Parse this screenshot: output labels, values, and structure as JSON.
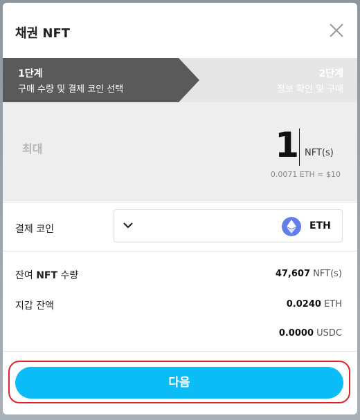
{
  "dialog": {
    "title_prefix": "채권",
    "title_suffix": "NFT"
  },
  "steps": [
    {
      "number": "1",
      "suffix": "단계",
      "label": "구매 수량 및 결제 코인 선택",
      "active": true
    },
    {
      "number": "2",
      "suffix": "단계",
      "label": "정보 확인 및 구매",
      "active": false
    }
  ],
  "quantity": {
    "max_label": "최대",
    "value": "1",
    "unit": "NFT(s)",
    "conversion": "0.0071 ETH ≈ $10"
  },
  "payment": {
    "label": "결제 코인",
    "selected_coin": "ETH",
    "coin_icon": "ethereum-icon"
  },
  "info": {
    "remaining_label_pre": "잔여",
    "remaining_label_bold": "NFT",
    "remaining_label_post": "수량",
    "remaining_value": "47,607",
    "remaining_unit": "NFT(s)",
    "wallet_label": "지갑 잔액",
    "wallet_eth_value": "0.0240",
    "wallet_eth_unit": "ETH",
    "wallet_usdc_value": "0.0000",
    "wallet_usdc_unit": "USDC"
  },
  "actions": {
    "next_label": "다음"
  },
  "colors": {
    "accent": "#0cbcf7",
    "step_active": "#5a5a5a",
    "step_inactive": "#e6e6e6",
    "highlight": "#e0242e",
    "eth": "#627eea"
  }
}
